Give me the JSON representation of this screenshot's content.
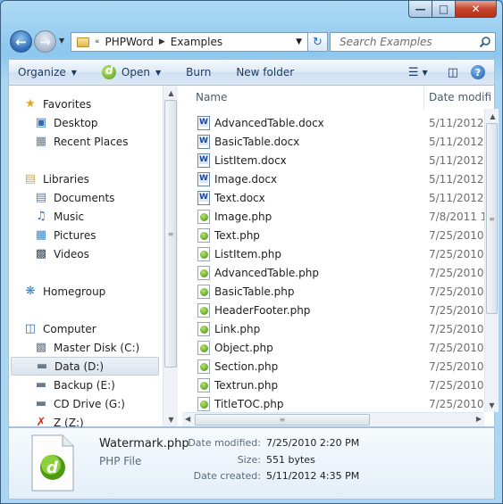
{
  "window": {
    "caption_buttons": {
      "minimize": "—",
      "maximize": "□",
      "close": "✕"
    }
  },
  "address": {
    "overflow": "«",
    "crumbs": [
      "PHPWord",
      "Examples"
    ],
    "search_placeholder": "Search Examples"
  },
  "toolbar": {
    "organize": "Organize",
    "open": "Open",
    "burn": "Burn",
    "new_folder": "New folder"
  },
  "nav": {
    "favorites": "Favorites",
    "desktop": "Desktop",
    "recent_places": "Recent Places",
    "libraries": "Libraries",
    "documents": "Documents",
    "music": "Music",
    "pictures": "Pictures",
    "videos": "Videos",
    "homegroup": "Homegroup",
    "computer": "Computer",
    "drives": [
      "Master Disk (C:)",
      "Data (D:)",
      "Backup (E:)",
      "CD Drive (G:)",
      "Z (Z:)"
    ],
    "selected": "Data (D:)"
  },
  "columns": {
    "name": "Name",
    "date": "Date modifi"
  },
  "files": [
    {
      "name": "AdvancedTable.docx",
      "date": "5/11/2012 4",
      "type": "docx"
    },
    {
      "name": "BasicTable.docx",
      "date": "5/11/2012 4",
      "type": "docx"
    },
    {
      "name": "ListItem.docx",
      "date": "5/11/2012 4",
      "type": "docx"
    },
    {
      "name": "Image.docx",
      "date": "5/11/2012 4",
      "type": "docx"
    },
    {
      "name": "Text.docx",
      "date": "5/11/2012 4",
      "type": "docx"
    },
    {
      "name": "Image.php",
      "date": "7/8/2011 1:0",
      "type": "php"
    },
    {
      "name": "Text.php",
      "date": "7/25/2010 2",
      "type": "php"
    },
    {
      "name": "ListItem.php",
      "date": "7/25/2010 2",
      "type": "php"
    },
    {
      "name": "AdvancedTable.php",
      "date": "7/25/2010 2",
      "type": "php"
    },
    {
      "name": "BasicTable.php",
      "date": "7/25/2010 2",
      "type": "php"
    },
    {
      "name": "HeaderFooter.php",
      "date": "7/25/2010 2",
      "type": "php"
    },
    {
      "name": "Link.php",
      "date": "7/25/2010 2",
      "type": "php"
    },
    {
      "name": "Object.php",
      "date": "7/25/2010 2",
      "type": "php"
    },
    {
      "name": "Section.php",
      "date": "7/25/2010 2",
      "type": "php"
    },
    {
      "name": "Textrun.php",
      "date": "7/25/2010 2",
      "type": "php"
    },
    {
      "name": "TitleTOC.php",
      "date": "7/25/2010 2",
      "type": "php"
    }
  ],
  "details": {
    "name": "Watermark.php",
    "type": "PHP File",
    "date_modified_label": "Date modified:",
    "date_modified": "7/25/2010 2:20 PM",
    "size_label": "Size:",
    "size": "551 bytes",
    "date_created_label": "Date created:",
    "date_created": "5/11/2012 4:35 PM"
  }
}
